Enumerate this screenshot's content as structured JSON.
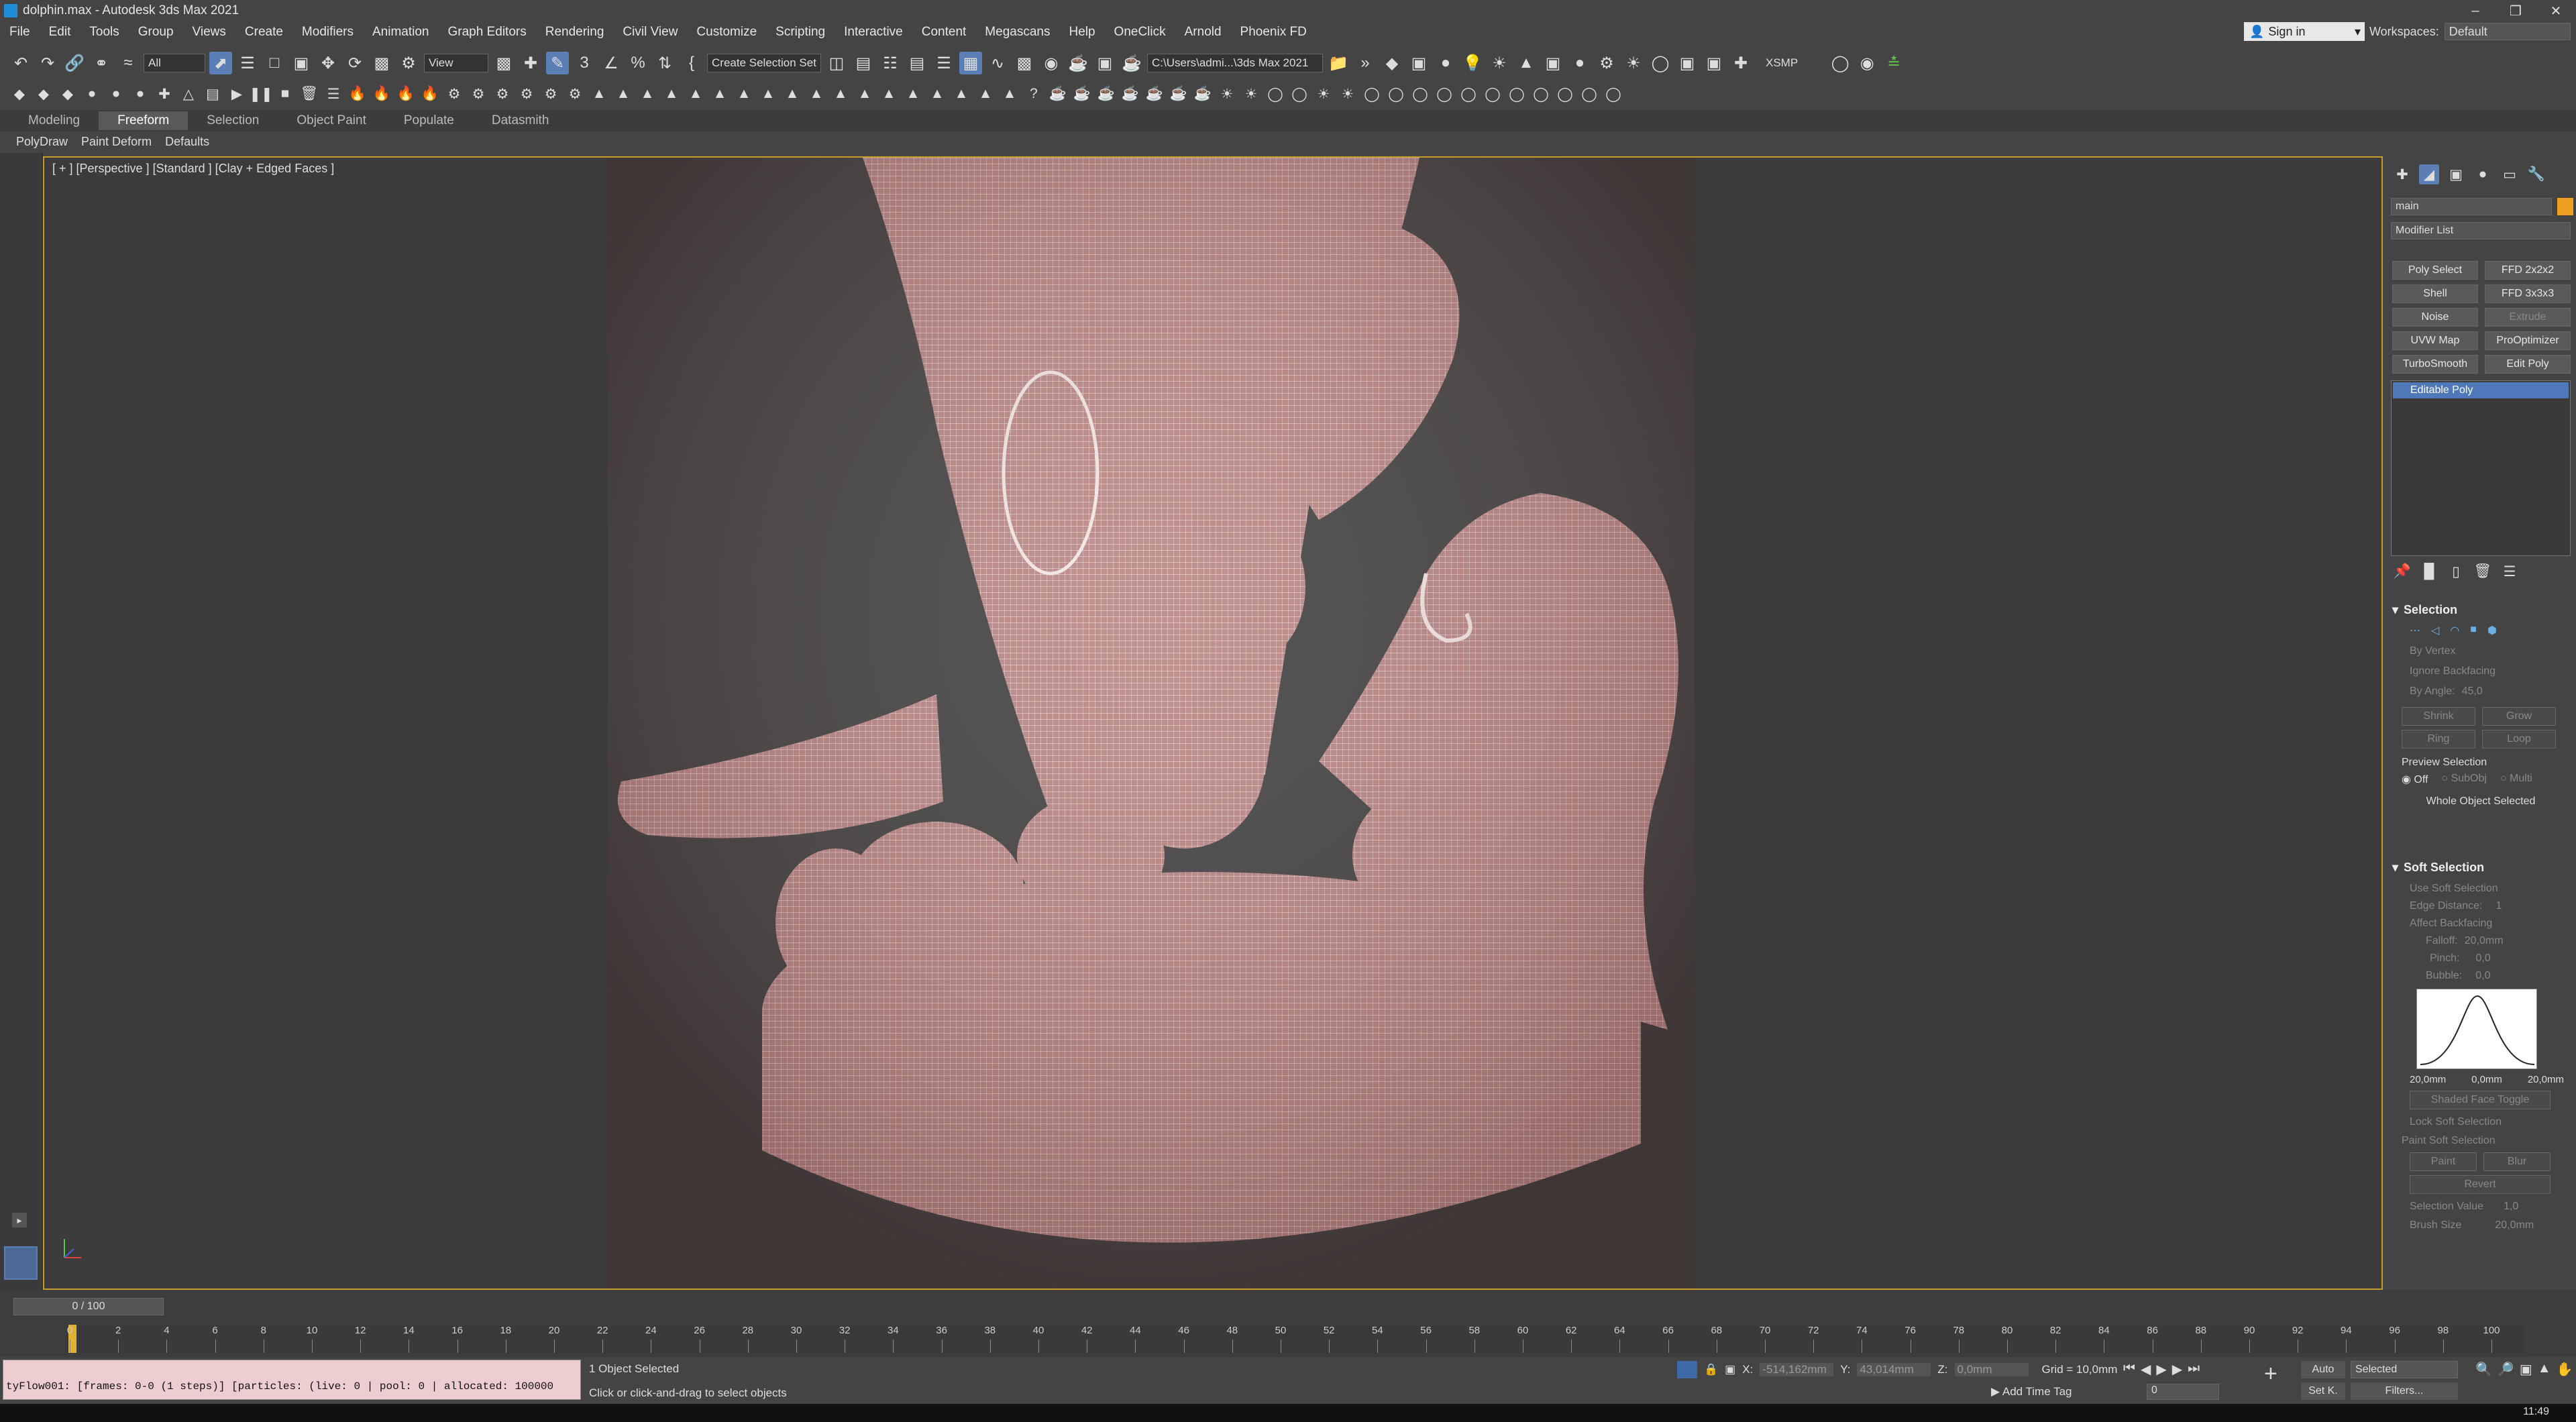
{
  "window": {
    "title": "dolphin.max - Autodesk 3ds Max 2021"
  },
  "menu": [
    "File",
    "Edit",
    "Tools",
    "Group",
    "Views",
    "Create",
    "Modifiers",
    "Animation",
    "Graph Editors",
    "Rendering",
    "Civil View",
    "Customize",
    "Scripting",
    "Interactive",
    "Content",
    "Megascans",
    "Help",
    "OneClick",
    "Arnold",
    "Phoenix FD"
  ],
  "account": {
    "signin": "Sign in",
    "workspaces_label": "Workspaces:",
    "workspace": "Default"
  },
  "toolbar": {
    "filter": "All",
    "coord": "View",
    "selset": "Create Selection Set",
    "path": "C:\\Users\\admi...\\3ds Max 2021",
    "xsmp": "XSMP"
  },
  "ribbon": {
    "tabs": [
      "Modeling",
      "Freeform",
      "Selection",
      "Object Paint",
      "Populate",
      "Datasmith"
    ],
    "active": "Freeform",
    "sub": [
      "PolyDraw",
      "Paint Deform",
      "Defaults"
    ]
  },
  "viewport": {
    "label": "[ + ] [Perspective ] [Standard ] [Clay + Edged Faces ]"
  },
  "cmd": {
    "objname": "main",
    "modlist": "Modifier List",
    "modbuttons": [
      "Poly Select",
      "FFD 2x2x2",
      "Shell",
      "FFD 3x3x3",
      "Noise",
      "Extrude",
      "UVW Map",
      "ProOptimizer",
      "TurboSmooth",
      "Edit Poly"
    ],
    "stack": "Editable Poly",
    "selection": {
      "title": "Selection",
      "by_vertex": "By Vertex",
      "ignore_backfacing": "Ignore Backfacing",
      "by_angle": "By Angle:",
      "angle": "45,0",
      "shrink": "Shrink",
      "grow": "Grow",
      "ring": "Ring",
      "loop": "Loop",
      "preview": "Preview Selection",
      "off": "Off",
      "subobj": "SubObj",
      "multi": "Multi",
      "status": "Whole Object Selected"
    },
    "soft": {
      "title": "Soft Selection",
      "use": "Use Soft Selection",
      "edge_distance": "Edge Distance:",
      "edge_value": "1",
      "affect_backfacing": "Affect Backfacing",
      "falloff": "Falloff:",
      "falloff_value": "20,0mm",
      "pinch": "Pinch:",
      "pinch_value": "0,0",
      "bubble": "Bubble:",
      "bubble_value": "0,0",
      "curve_left": "20,0mm",
      "curve_mid": "0,0mm",
      "curve_right": "20,0mm",
      "shaded_face": "Shaded Face Toggle",
      "lock": "Lock Soft Selection",
      "paint_title": "Paint Soft Selection",
      "paint": "Paint",
      "blur": "Blur",
      "revert": "Revert",
      "sel_value": "Selection Value",
      "sel_value_v": "1,0",
      "brush_size": "Brush Size",
      "brush_size_v": "20,0mm"
    }
  },
  "timeline": {
    "frame": "0 / 100",
    "ticks": [
      "0",
      "2",
      "4",
      "6",
      "8",
      "10",
      "12",
      "14",
      "16",
      "18",
      "20",
      "22",
      "24",
      "26",
      "28",
      "30",
      "32",
      "34",
      "36",
      "38",
      "40",
      "42",
      "44",
      "46",
      "48",
      "50",
      "52",
      "54",
      "56",
      "58",
      "60",
      "62",
      "64",
      "66",
      "68",
      "70",
      "72",
      "74",
      "76",
      "78",
      "80",
      "82",
      "84",
      "86",
      "88",
      "90",
      "92",
      "94",
      "96",
      "98",
      "100"
    ]
  },
  "status": {
    "script": "tyFlow001: [frames: 0-0 (1 steps)] [particles: (live: 0 | pool: 0 | allocated: 100000",
    "selected": "1 Object Selected",
    "hint": "Click or click-and-drag to select objects",
    "x_label": "X:",
    "x": "-514,162mm",
    "y_label": "Y:",
    "y": "43,014mm",
    "z_label": "Z:",
    "z": "0,0mm",
    "grid": "Grid = 10,0mm",
    "addtag": "Add Time Tag",
    "auto": "Auto",
    "setk": "Set K.",
    "selected_dd": "Selected",
    "filters": "Filters...",
    "frame": "0",
    "clock": "11:49"
  }
}
